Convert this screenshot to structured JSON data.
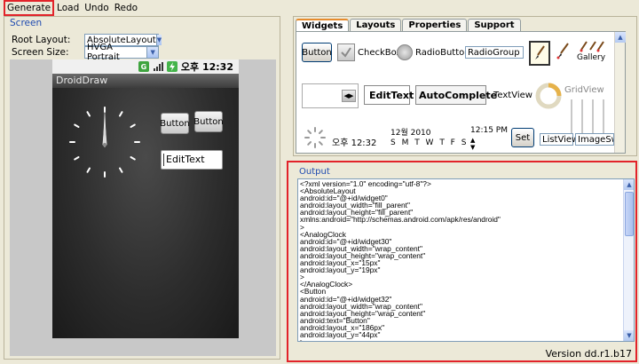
{
  "menu": [
    "Generate",
    "Load",
    "Undo",
    "Redo"
  ],
  "screen_panel": {
    "title": "Screen",
    "root_layout_label": "Root Layout:",
    "root_layout_value": "AbsoluteLayout",
    "screen_size_label": "Screen Size:",
    "screen_size_value": "HVGA Portrait"
  },
  "device": {
    "status_time": "오후 12:32",
    "status_icon_g": "G",
    "title": "DroidDraw",
    "button1": "Button",
    "button2": "Button",
    "edittext": "EditText"
  },
  "widget_panel": {
    "tabs": [
      "Widgets",
      "Layouts",
      "Properties",
      "Support"
    ],
    "button": "Button",
    "checkbox": "CheckBox",
    "radiobutton": "RadioButton",
    "radiogroup": "RadioGroup",
    "gallery": "Gallery",
    "edittext": "EditText",
    "autocomplete": "AutoComplete",
    "textview": "TextView",
    "gridview": "GridView",
    "digital_clock": "오후 12:32",
    "date_month": "12월 2010",
    "weekdays": "S M T W T F S",
    "time_picker": "12:15 PM",
    "set_button": "Set",
    "listview": "ListView",
    "imageswitcher": "ImageSwitcher"
  },
  "output": {
    "title": "Output",
    "code": "<?xml version=\"1.0\" encoding=\"utf-8\"?>\n<AbsoluteLayout\nandroid:id=\"@+id/widget0\"\nandroid:layout_width=\"fill_parent\"\nandroid:layout_height=\"fill_parent\"\nxmlns:android=\"http://schemas.android.com/apk/res/android\"\n>\n<AnalogClock\nandroid:id=\"@+id/widget30\"\nandroid:layout_width=\"wrap_content\"\nandroid:layout_height=\"wrap_content\"\nandroid:layout_x=\"15px\"\nandroid:layout_y=\"19px\"\n>\n</AnalogClock>\n<Button\nandroid:id=\"@+id/widget32\"\nandroid:layout_width=\"wrap_content\"\nandroid:layout_height=\"wrap_content\"\nandroid:text=\"Button\"\nandroid:layout_x=\"186px\"\nandroid:layout_y=\"44px\"\n>\n</Button>"
  },
  "version": "Version dd.r1.b17",
  "colors": {
    "highlight": "#e2232a",
    "panel_title": "#1f4bb0",
    "active_tab": "#e68b2c"
  }
}
